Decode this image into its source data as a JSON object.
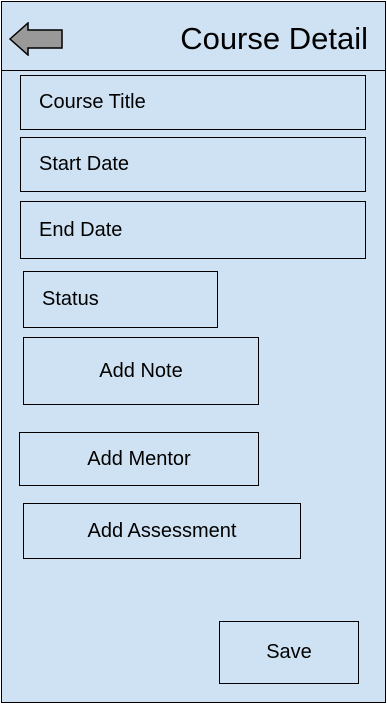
{
  "header": {
    "back_icon": "left-arrow-icon",
    "title": "Course Detail"
  },
  "form": {
    "course_title_placeholder": "Course Title",
    "start_date_placeholder": "Start Date",
    "end_date_placeholder": "End Date",
    "status_placeholder": "Status"
  },
  "actions": {
    "add_note_label": "Add Note",
    "add_mentor_label": "Add Mentor",
    "add_assessment_label": "Add Assessment",
    "save_label": "Save"
  },
  "colors": {
    "background": "#cfe2f3",
    "border": "#000000",
    "icon_fill": "#999999"
  }
}
